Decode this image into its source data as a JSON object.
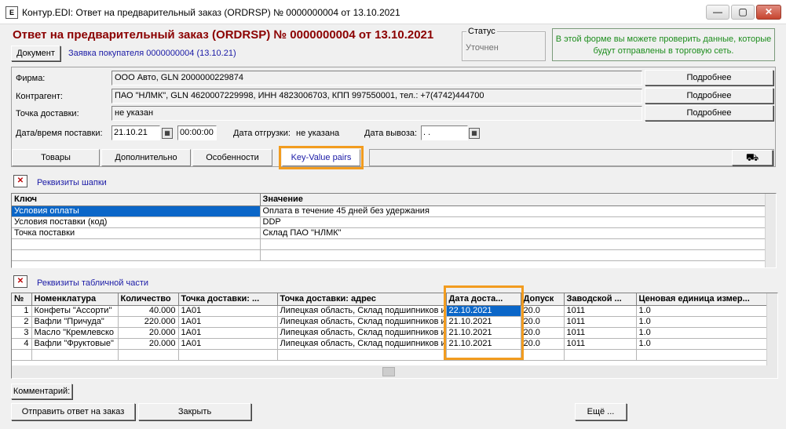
{
  "window": {
    "title": "Контур.EDI: Ответ на предварительный заказ (ORDRSP) № 0000000004 от 13.10.2021",
    "icon": "document-icon",
    "buttons": {
      "minimize": "—",
      "maximize": "▢",
      "close": "✕"
    }
  },
  "header": {
    "doc_title": "Ответ на предварительный заказ (ORDRSP) № 0000000004 от 13.10.2021",
    "document_button": "Документ",
    "customer_order_link": "Заявка покупателя 0000000004 (13.10.21)",
    "status_legend": "Статус",
    "status_value": "Уточнен",
    "info_text": "В этой форме вы можете проверить данные, которые будут отправлены в торговую сеть."
  },
  "form": {
    "firm_label": "Фирма:",
    "firm_value": "ООО Авто, GLN 2000000229874",
    "contractor_label": "Контрагент:",
    "contractor_value": "ПАО \"НЛМК\", GLN 4620007229998, ИНН 4823006703, КПП 997550001, тел.: +7(4742)444700",
    "delivery_point_label": "Точка доставки:",
    "delivery_point_value": "не указан",
    "details_button": "Подробнее",
    "delivery_datetime_label": "Дата/время поставки:",
    "delivery_date": "21.10.21",
    "delivery_time": "00:00:00",
    "shipment_date_label": "Дата отгрузки:",
    "shipment_date_value": "не указана",
    "pickup_date_label": "Дата вывоза:",
    "pickup_date_value": " .  ."
  },
  "tabs": [
    {
      "label": "Товары"
    },
    {
      "label": "Дополнительно"
    },
    {
      "label": "Особенности"
    },
    {
      "label": "Key-Value pairs"
    }
  ],
  "header_requisites": {
    "title": "Реквизиты шапки",
    "columns": [
      "Ключ",
      "Значение"
    ],
    "rows": [
      [
        "Условия оплаты",
        "Оплата в течение 45 дней без удержания"
      ],
      [
        "Условия поставки (код)",
        "DDP"
      ],
      [
        "Точка поставки",
        "Склад ПАО \"НЛМК\""
      ]
    ]
  },
  "table_requisites": {
    "title": "Реквизиты табличной части",
    "columns": [
      "№",
      "Номенклатура",
      "Количество",
      "Точка доставки: ...",
      "Точка доставки: адрес",
      "Дата доста...",
      "Допуск",
      "Заводской ...",
      "Ценовая единица измер..."
    ],
    "rows": [
      [
        "1",
        "Конфеты \"Ассорти\"",
        "40.000",
        "1А01",
        "Липецкая область, Склад подшипников и",
        "22.10.2021",
        "20.0",
        "1011",
        "1.0"
      ],
      [
        "2",
        "Вафли \"Причуда\"",
        "220.000",
        "1А01",
        "Липецкая область, Склад подшипников и",
        "21.10.2021",
        "20.0",
        "1011",
        "1.0"
      ],
      [
        "3",
        "Масло \"Кремлевско",
        "20.000",
        "1А01",
        "Липецкая область, Склад подшипников и",
        "21.10.2021",
        "20.0",
        "1011",
        "1.0"
      ],
      [
        "4",
        "Вафли \"Фруктовые\"",
        "20.000",
        "1А01",
        "Липецкая область, Склад подшипников и",
        "21.10.2021",
        "20.0",
        "1011",
        "1.0"
      ]
    ]
  },
  "footer": {
    "comment_button": "Комментарий:",
    "send_button": "Отправить ответ на заказ",
    "close_button": "Закрыть",
    "more_button": "Ещё ..."
  },
  "colors": {
    "title": "#8b0000",
    "info": "#1d8d1d",
    "highlight": "#f29c1f",
    "selection": "#0a66c8",
    "link": "#1a1aa6"
  }
}
